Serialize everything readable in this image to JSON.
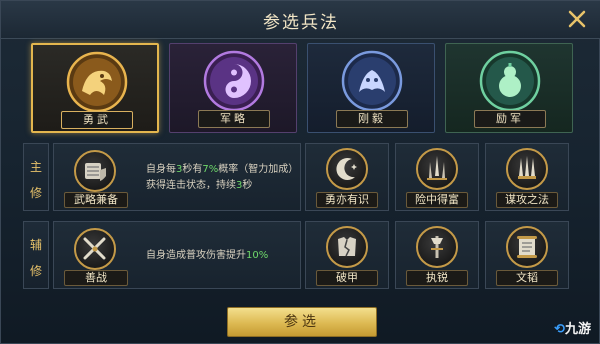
{
  "title": "参选兵法",
  "colors": {
    "gold": "#e3b64e",
    "green_highlight": "#6fd86a"
  },
  "categories": [
    {
      "label": "勇武",
      "icon": "dragon-emblem-icon",
      "selected": true
    },
    {
      "label": "军略",
      "icon": "yin-yang-emblem-icon",
      "selected": false
    },
    {
      "label": "刚毅",
      "icon": "beast-emblem-icon",
      "selected": false
    },
    {
      "label": "励军",
      "icon": "gourd-emblem-icon",
      "selected": false
    }
  ],
  "main_row": {
    "label_1": "主",
    "label_2": "修",
    "primary": {
      "name": "武略兼备",
      "desc_parts": [
        "自身每",
        "3",
        "秒有",
        "7%",
        "概率（智力加成）获得连击状态，持续",
        "3",
        "秒"
      ]
    },
    "options": [
      "勇亦有识",
      "险中得富",
      "谋攻之法"
    ]
  },
  "aux_row": {
    "label_1": "辅",
    "label_2": "修",
    "primary": {
      "name": "善战",
      "desc_parts": [
        "自身造成普攻伤害提升",
        "10%"
      ]
    },
    "options": [
      "破甲",
      "执锐",
      "文韬"
    ]
  },
  "confirm_label": "参选",
  "watermark": "九游"
}
